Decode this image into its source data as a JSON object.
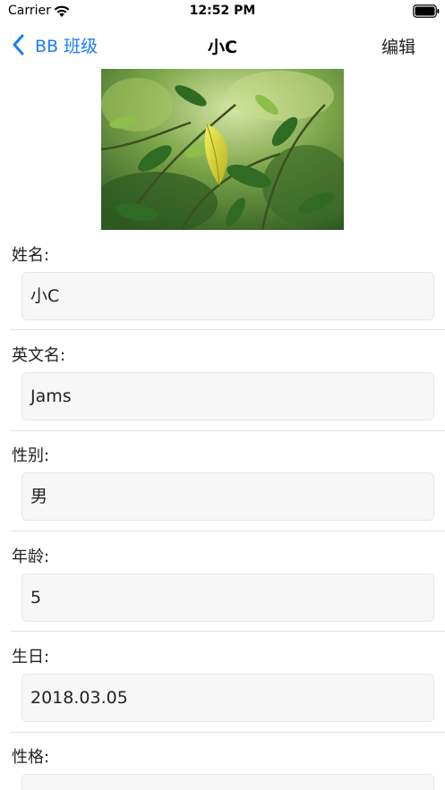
{
  "status_bar": {
    "carrier": "Carrier",
    "time": "12:52 PM"
  },
  "nav": {
    "back_label": "BB 班级",
    "title": "小C",
    "edit_label": "编辑"
  },
  "photo": {
    "icon": "leaf-photo"
  },
  "fields": [
    {
      "label": "姓名:",
      "value": "小C"
    },
    {
      "label": "英文名:",
      "value": "Jams"
    },
    {
      "label": "性别:",
      "value": "男"
    },
    {
      "label": "年龄:",
      "value": "5"
    },
    {
      "label": "生日:",
      "value": "2018.03.05"
    },
    {
      "label": "性格:",
      "value": ""
    }
  ],
  "colors": {
    "accent": "#1a7cf5",
    "field_bg": "#f7f7f7",
    "divider": "#e3e3e3"
  }
}
